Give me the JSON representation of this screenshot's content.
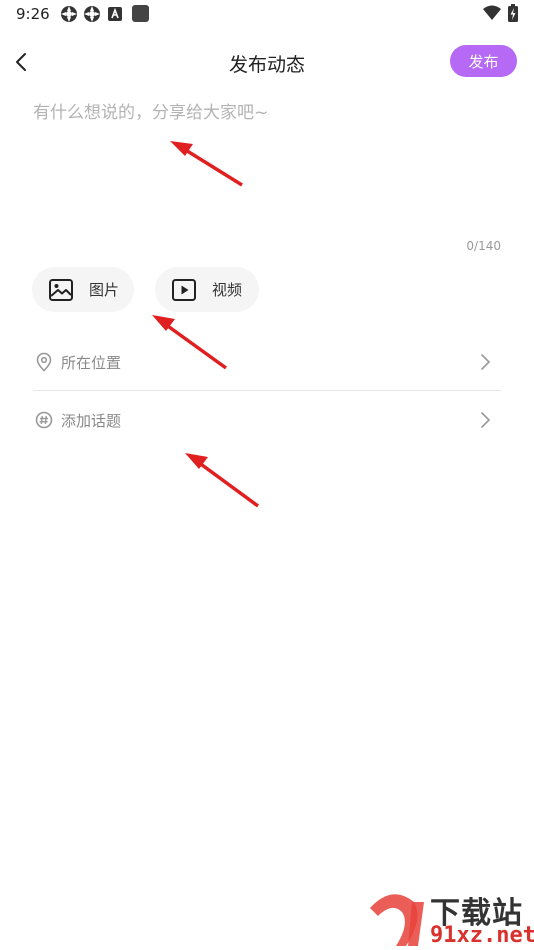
{
  "status_bar": {
    "time": "9:26",
    "icons_left": [
      "sync-icon",
      "sync-icon",
      "a-badge-icon",
      "square-icon"
    ],
    "icons_right": [
      "wifi-icon",
      "battery-charging-icon"
    ]
  },
  "header": {
    "title": "发布动态",
    "publish_label": "发布"
  },
  "compose": {
    "placeholder": "有什么想说的，分享给大家吧~",
    "char_count": "0/140"
  },
  "media": {
    "image_label": "图片",
    "video_label": "视频"
  },
  "options": {
    "location_label": "所在位置",
    "topic_label": "添加话题"
  },
  "watermark": {
    "title": "下载站",
    "domain": "91xz.net"
  },
  "colors": {
    "accent": "#b569f5",
    "arrow": "#e02020",
    "placeholder": "#b3b3b3"
  }
}
